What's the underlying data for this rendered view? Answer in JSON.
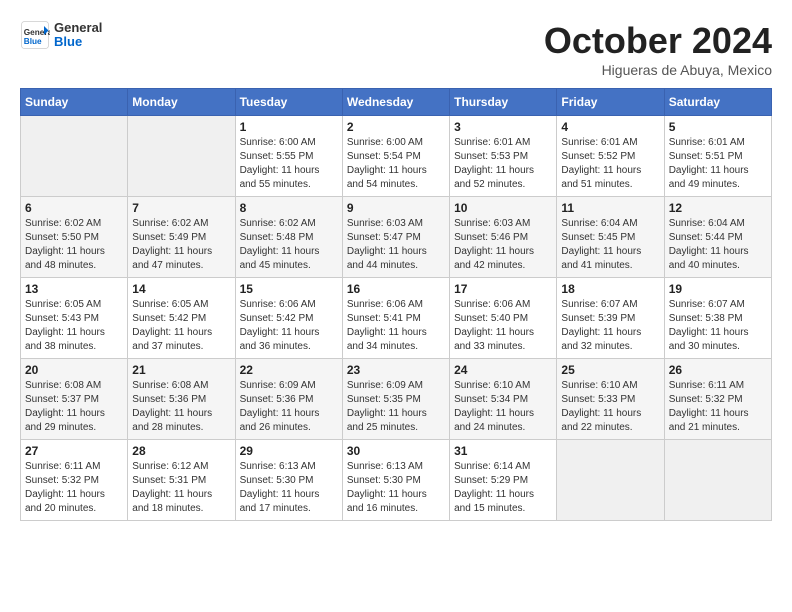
{
  "header": {
    "logo_text_general": "General",
    "logo_text_blue": "Blue",
    "month": "October 2024",
    "location": "Higueras de Abuya, Mexico"
  },
  "weekdays": [
    "Sunday",
    "Monday",
    "Tuesday",
    "Wednesday",
    "Thursday",
    "Friday",
    "Saturday"
  ],
  "weeks": [
    [
      {
        "day": "",
        "info": ""
      },
      {
        "day": "",
        "info": ""
      },
      {
        "day": "1",
        "info": "Sunrise: 6:00 AM\nSunset: 5:55 PM\nDaylight: 11 hours and 55 minutes."
      },
      {
        "day": "2",
        "info": "Sunrise: 6:00 AM\nSunset: 5:54 PM\nDaylight: 11 hours and 54 minutes."
      },
      {
        "day": "3",
        "info": "Sunrise: 6:01 AM\nSunset: 5:53 PM\nDaylight: 11 hours and 52 minutes."
      },
      {
        "day": "4",
        "info": "Sunrise: 6:01 AM\nSunset: 5:52 PM\nDaylight: 11 hours and 51 minutes."
      },
      {
        "day": "5",
        "info": "Sunrise: 6:01 AM\nSunset: 5:51 PM\nDaylight: 11 hours and 49 minutes."
      }
    ],
    [
      {
        "day": "6",
        "info": "Sunrise: 6:02 AM\nSunset: 5:50 PM\nDaylight: 11 hours and 48 minutes."
      },
      {
        "day": "7",
        "info": "Sunrise: 6:02 AM\nSunset: 5:49 PM\nDaylight: 11 hours and 47 minutes."
      },
      {
        "day": "8",
        "info": "Sunrise: 6:02 AM\nSunset: 5:48 PM\nDaylight: 11 hours and 45 minutes."
      },
      {
        "day": "9",
        "info": "Sunrise: 6:03 AM\nSunset: 5:47 PM\nDaylight: 11 hours and 44 minutes."
      },
      {
        "day": "10",
        "info": "Sunrise: 6:03 AM\nSunset: 5:46 PM\nDaylight: 11 hours and 42 minutes."
      },
      {
        "day": "11",
        "info": "Sunrise: 6:04 AM\nSunset: 5:45 PM\nDaylight: 11 hours and 41 minutes."
      },
      {
        "day": "12",
        "info": "Sunrise: 6:04 AM\nSunset: 5:44 PM\nDaylight: 11 hours and 40 minutes."
      }
    ],
    [
      {
        "day": "13",
        "info": "Sunrise: 6:05 AM\nSunset: 5:43 PM\nDaylight: 11 hours and 38 minutes."
      },
      {
        "day": "14",
        "info": "Sunrise: 6:05 AM\nSunset: 5:42 PM\nDaylight: 11 hours and 37 minutes."
      },
      {
        "day": "15",
        "info": "Sunrise: 6:06 AM\nSunset: 5:42 PM\nDaylight: 11 hours and 36 minutes."
      },
      {
        "day": "16",
        "info": "Sunrise: 6:06 AM\nSunset: 5:41 PM\nDaylight: 11 hours and 34 minutes."
      },
      {
        "day": "17",
        "info": "Sunrise: 6:06 AM\nSunset: 5:40 PM\nDaylight: 11 hours and 33 minutes."
      },
      {
        "day": "18",
        "info": "Sunrise: 6:07 AM\nSunset: 5:39 PM\nDaylight: 11 hours and 32 minutes."
      },
      {
        "day": "19",
        "info": "Sunrise: 6:07 AM\nSunset: 5:38 PM\nDaylight: 11 hours and 30 minutes."
      }
    ],
    [
      {
        "day": "20",
        "info": "Sunrise: 6:08 AM\nSunset: 5:37 PM\nDaylight: 11 hours and 29 minutes."
      },
      {
        "day": "21",
        "info": "Sunrise: 6:08 AM\nSunset: 5:36 PM\nDaylight: 11 hours and 28 minutes."
      },
      {
        "day": "22",
        "info": "Sunrise: 6:09 AM\nSunset: 5:36 PM\nDaylight: 11 hours and 26 minutes."
      },
      {
        "day": "23",
        "info": "Sunrise: 6:09 AM\nSunset: 5:35 PM\nDaylight: 11 hours and 25 minutes."
      },
      {
        "day": "24",
        "info": "Sunrise: 6:10 AM\nSunset: 5:34 PM\nDaylight: 11 hours and 24 minutes."
      },
      {
        "day": "25",
        "info": "Sunrise: 6:10 AM\nSunset: 5:33 PM\nDaylight: 11 hours and 22 minutes."
      },
      {
        "day": "26",
        "info": "Sunrise: 6:11 AM\nSunset: 5:32 PM\nDaylight: 11 hours and 21 minutes."
      }
    ],
    [
      {
        "day": "27",
        "info": "Sunrise: 6:11 AM\nSunset: 5:32 PM\nDaylight: 11 hours and 20 minutes."
      },
      {
        "day": "28",
        "info": "Sunrise: 6:12 AM\nSunset: 5:31 PM\nDaylight: 11 hours and 18 minutes."
      },
      {
        "day": "29",
        "info": "Sunrise: 6:13 AM\nSunset: 5:30 PM\nDaylight: 11 hours and 17 minutes."
      },
      {
        "day": "30",
        "info": "Sunrise: 6:13 AM\nSunset: 5:30 PM\nDaylight: 11 hours and 16 minutes."
      },
      {
        "day": "31",
        "info": "Sunrise: 6:14 AM\nSunset: 5:29 PM\nDaylight: 11 hours and 15 minutes."
      },
      {
        "day": "",
        "info": ""
      },
      {
        "day": "",
        "info": ""
      }
    ]
  ]
}
